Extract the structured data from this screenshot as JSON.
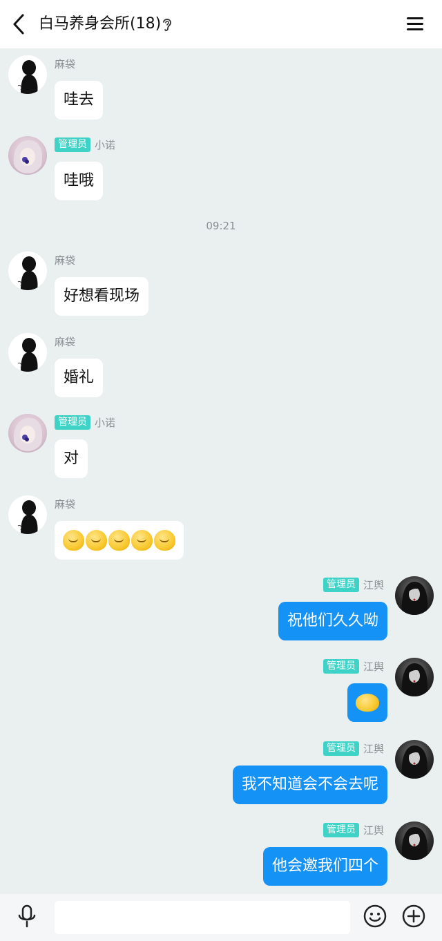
{
  "header": {
    "title": "白马养身会所(18)"
  },
  "timestamp": "09:21",
  "messages": [
    {
      "side": "left",
      "avatar": "a",
      "nick": "麻袋",
      "badge": "",
      "text": "哇去"
    },
    {
      "side": "left",
      "avatar": "b",
      "nick": "小诺",
      "badge": "管理员",
      "text": "哇哦"
    },
    {
      "side": "left",
      "avatar": "a",
      "nick": "麻袋",
      "badge": "",
      "text": "好想看现场"
    },
    {
      "side": "left",
      "avatar": "a",
      "nick": "麻袋",
      "badge": "",
      "text": "婚礼"
    },
    {
      "side": "left",
      "avatar": "b",
      "nick": "小诺",
      "badge": "管理员",
      "text": "对"
    },
    {
      "side": "left",
      "avatar": "a",
      "nick": "麻袋",
      "badge": "",
      "emoji_count": 5
    },
    {
      "side": "right",
      "avatar": "c",
      "nick": "江舆",
      "badge": "管理员",
      "text": "祝他们久久呦"
    },
    {
      "side": "right",
      "avatar": "c",
      "nick": "江舆",
      "badge": "管理员",
      "sticker": true
    },
    {
      "side": "right",
      "avatar": "c",
      "nick": "江舆",
      "badge": "管理员",
      "text": "我不知道会不会去呢"
    },
    {
      "side": "right",
      "avatar": "c",
      "nick": "江舆",
      "badge": "管理员",
      "text": "他会邀我们四个"
    }
  ],
  "icons": {
    "back": "back-arrow-icon",
    "listen": "ear-icon",
    "menu": "menu-icon",
    "mic": "microphone-icon",
    "emoji": "smiley-icon",
    "add": "plus-circle-icon"
  },
  "colors": {
    "background": "#eaeff0",
    "bubble_self": "#1592f6",
    "bubble_other": "#ffffff",
    "admin_badge": "#3fd3c8"
  },
  "input": {
    "value": "",
    "placeholder": ""
  }
}
